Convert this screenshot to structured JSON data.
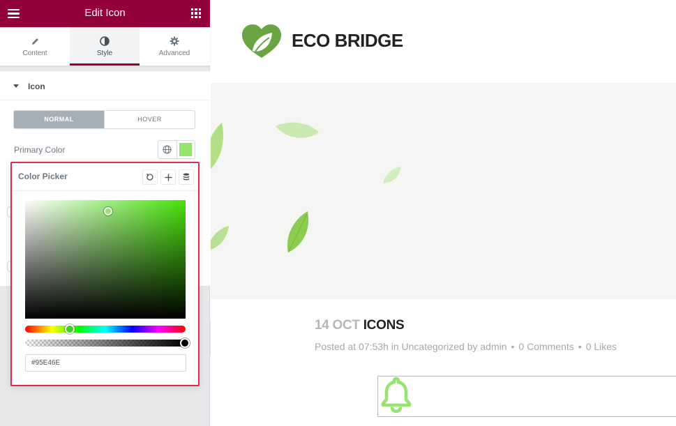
{
  "panel": {
    "title": "Edit Icon",
    "tabs": [
      {
        "label": "Content",
        "icon": "pencil-icon",
        "active": false
      },
      {
        "label": "Style",
        "icon": "contrast-icon",
        "active": true
      },
      {
        "label": "Advanced",
        "icon": "gear-icon",
        "active": false
      }
    ],
    "section_title": "Icon",
    "states": {
      "normal": "NORMAL",
      "hover": "HOVER",
      "active": "normal"
    },
    "primary_color_label": "Primary Color",
    "primary_color": "#95E46E"
  },
  "color_picker": {
    "title": "Color Picker",
    "tools": [
      "reset-icon",
      "add-icon",
      "stack-icon"
    ],
    "hex_value": "#95E46E",
    "hue_value": "#47e20a",
    "alpha": 1
  },
  "preview": {
    "brand": "ECO BRIDGE",
    "post_date": "14 OCT",
    "post_title": "ICONS",
    "meta": {
      "posted_at": "Posted at 07:53h in Uncategorized by admin",
      "comments": "0 Comments",
      "likes": "0 Likes"
    },
    "icon_color": "#95E46E"
  },
  "colors": {
    "header": "#93003c",
    "highlight_border": "#e0294e",
    "leaf": "#9fd86b"
  }
}
